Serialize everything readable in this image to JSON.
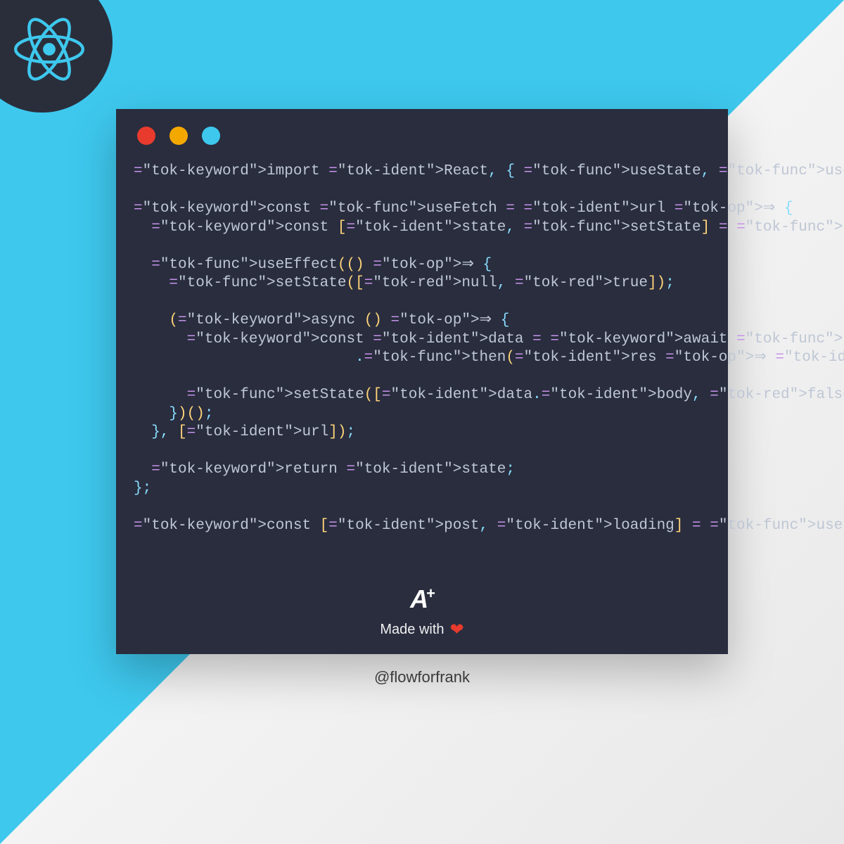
{
  "colors": {
    "accent_blue": "#3ec8ee",
    "card_bg": "#292d3e",
    "dot_red": "#e83b2e",
    "dot_yellow": "#f3a800",
    "dot_blue": "#3ec8ee"
  },
  "code": {
    "lines": [
      "import React, { useState, useEffect } from 'react'",
      "",
      "const useFetch = url ⇒ {",
      "  const [state, setState] = useState([null, false]);",
      "",
      "  useEffect(() ⇒ {",
      "    setState([null, true]);",
      "",
      "    (async () ⇒ {",
      "      const data = await fetch(url)",
      "                         .then(res ⇒ res.json());",
      "",
      "      setState([data.body, false]);",
      "    })();",
      "  }, [url]);",
      "",
      "  return state;",
      "};",
      "",
      "const [post, loading] = useFetch('url/to/fetch');"
    ]
  },
  "footer": {
    "logo_text": "A",
    "logo_plus": "+",
    "made_with": "Made with",
    "heart": "❤"
  },
  "handle": "@flowforfrank"
}
